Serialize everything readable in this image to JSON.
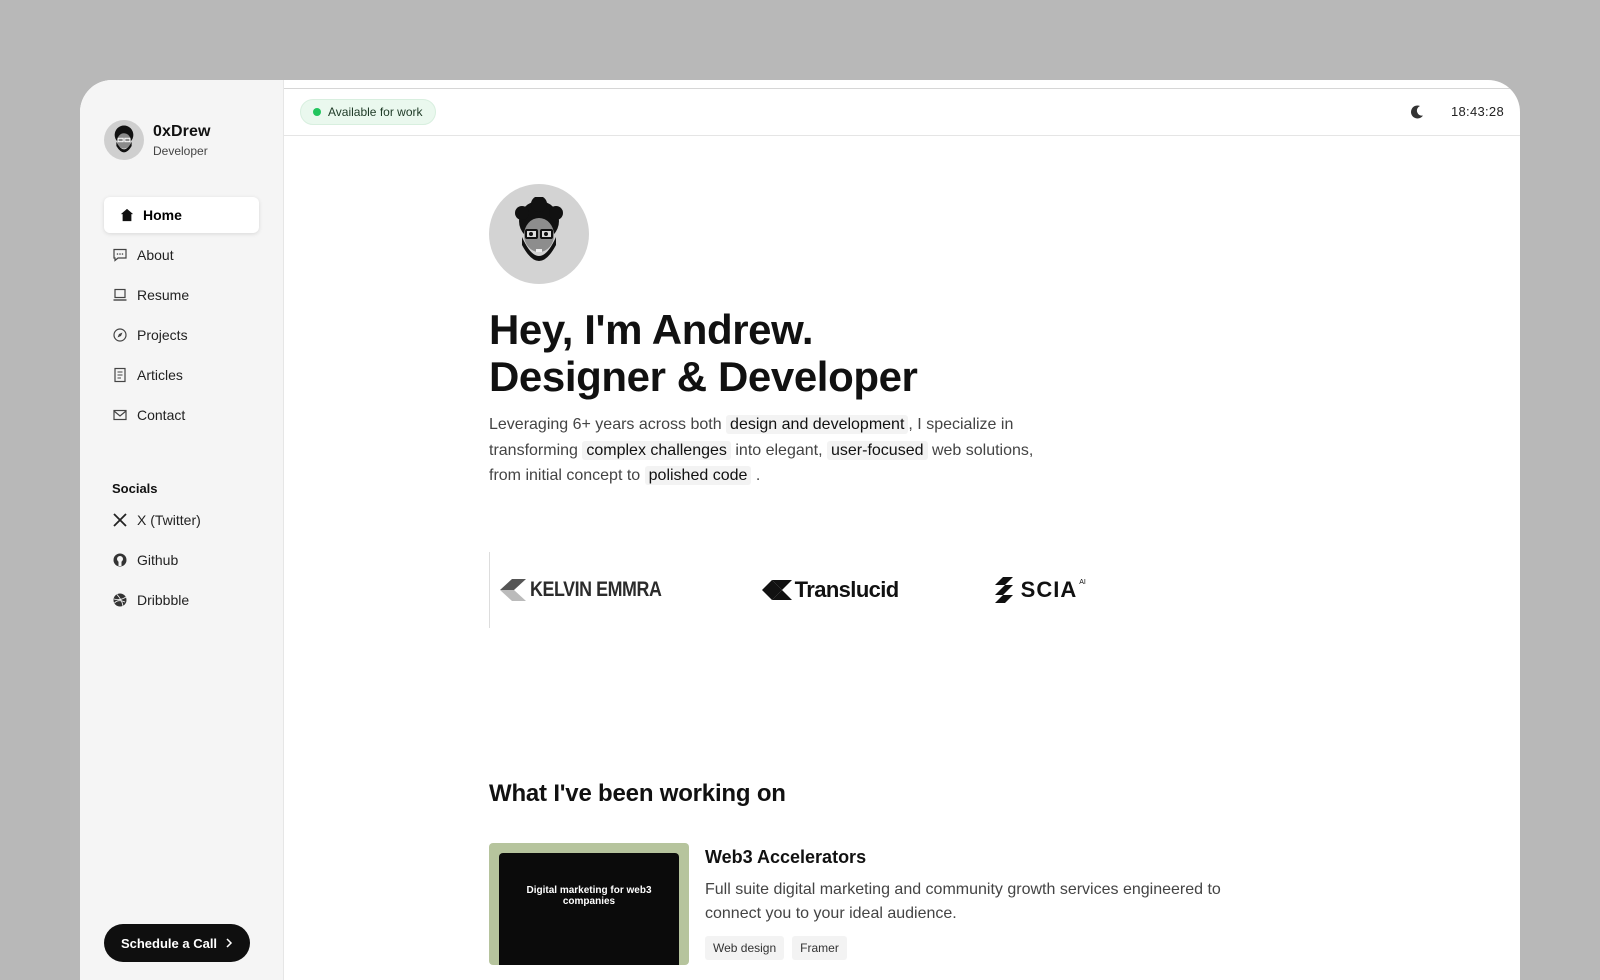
{
  "profile": {
    "name": "0xDrew",
    "role": "Developer"
  },
  "nav": {
    "items": [
      {
        "label": "Home",
        "icon": "home-icon"
      },
      {
        "label": "About",
        "icon": "chat-icon"
      },
      {
        "label": "Resume",
        "icon": "laptop-icon"
      },
      {
        "label": "Projects",
        "icon": "compass-icon"
      },
      {
        "label": "Articles",
        "icon": "document-icon"
      },
      {
        "label": "Contact",
        "icon": "mail-icon"
      }
    ],
    "active": "Home"
  },
  "socials": {
    "title": "Socials",
    "items": [
      {
        "label": "X (Twitter)",
        "icon": "x-icon"
      },
      {
        "label": "Github",
        "icon": "github-icon"
      },
      {
        "label": "Dribbble",
        "icon": "dribbble-icon"
      }
    ]
  },
  "cta": {
    "label": "Schedule a Call"
  },
  "topbar": {
    "status": "Available for work",
    "time": "18:43:28",
    "status_color": "#22c55e"
  },
  "hero": {
    "line1": "Hey, I'm Andrew.",
    "line2": "Designer & Developer",
    "intro": {
      "t1": "Leveraging 6+ years across both",
      "h1": "design and development",
      "t2": ", I specialize in transforming",
      "h2": "complex challenges",
      "t3": "into elegant,",
      "h3": "user-focused",
      "t4": "web solutions, from initial concept to",
      "h4": "polished code",
      "t5": "."
    }
  },
  "logos": {
    "l1": "KELVIN EMMRA",
    "l2": "Translucid",
    "l3": "SCIA",
    "l3_sup": "AI"
  },
  "work": {
    "title": "What I've been working on",
    "project": {
      "title": "Web3 Accelerators",
      "description": "Full suite digital marketing and community growth services engineered to connect you to your ideal audience.",
      "thumb_title": "Digital marketing for web3 companies",
      "tags": [
        "Web design",
        "Framer"
      ]
    }
  }
}
